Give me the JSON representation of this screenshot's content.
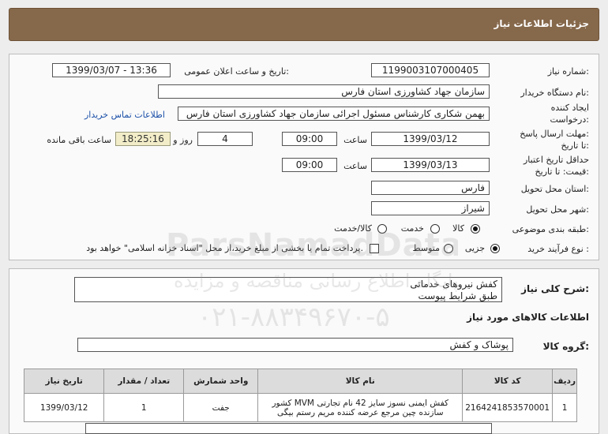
{
  "header": {
    "title": "جزئیات اطلاعات نیاز"
  },
  "form": {
    "need_number_label": "شماره نیاز:",
    "need_number": "1199003107000405",
    "announce_label": "تاریخ و ساعت اعلان عمومی:",
    "announce_value": "1399/03/07 - 13:36",
    "buyer_label": "نام دستگاه خریدار:",
    "buyer_value": "سازمان جهاد کشاورزی استان فارس",
    "creator_label_1": "ایجاد کننده",
    "creator_label_2": "درخواست:",
    "creator_value": "بهمن شکاری کارشناس مسئول اجرائی سازمان جهاد کشاورزی استان فارس",
    "contact_link": "اطلاعات تماس خریدار",
    "send_deadline_label_1": "مهلت ارسال پاسخ:",
    "send_deadline_label_2": "تا تاریخ:",
    "send_date": "1399/03/12",
    "time_label": "ساعت",
    "send_time": "09:00",
    "days_value": "4",
    "days_label": "روز و",
    "remaining_time": "18:25:16",
    "remaining_label": "ساعت باقی مانده",
    "validity_label_1": "حداقل تاریخ اعتبار",
    "validity_label_2": "قیمت: تا تاریخ:",
    "validity_date": "1399/03/13",
    "validity_time": "09:00",
    "province_label": "استان محل تحویل:",
    "province_value": "فارس",
    "city_label": "شهر محل تحویل:",
    "city_value": "شیراز",
    "category_label": "طبقه بندی موضوعی:",
    "category_options": [
      "کالا",
      "خدمت",
      "کالا/خدمت"
    ],
    "category_selected": "کالا",
    "process_label": "نوع فرآیند خرید :",
    "process_options": [
      "جزیی",
      "متوسط"
    ],
    "process_selected": "جزیی",
    "payment_note": "پرداخت تمام یا بخشی از مبلغ خرید،از محل \"اسناد خزانه اسلامی\" خواهد بود."
  },
  "details": {
    "summary_label": "شرح کلی نیاز:",
    "summary_line1": "کفش نیروهای خدماتی",
    "summary_line2": "طبق شرایط پیوست",
    "goods_info_title": "اطلاعات کالاهای مورد نیاز",
    "goods_group_label": "گروه کالا:",
    "goods_group_value": "پوشاک و کفش"
  },
  "table": {
    "headers": [
      "ردیف",
      "کد کالا",
      "نام کالا",
      "واحد شمارش",
      "تعداد / مقدار",
      "تاریخ نیاز"
    ],
    "rows": [
      {
        "row": "1",
        "code": "2164241853570001",
        "name": "کفش ایمنی نسوز سایز 42 نام تجارتی MVM کشور سازنده چین مرجع عرضه کننده مریم رستم بیگی",
        "unit": "جفت",
        "qty": "1",
        "date": "1399/03/12"
      }
    ]
  },
  "watermark": {
    "line1": "ParsNamadData",
    "line2": "پایگاه اطلاع رسانی مناقصه و مزایده",
    "line3": "۰۲۱-۸۸۳۴۹۶۷۰-۵"
  }
}
